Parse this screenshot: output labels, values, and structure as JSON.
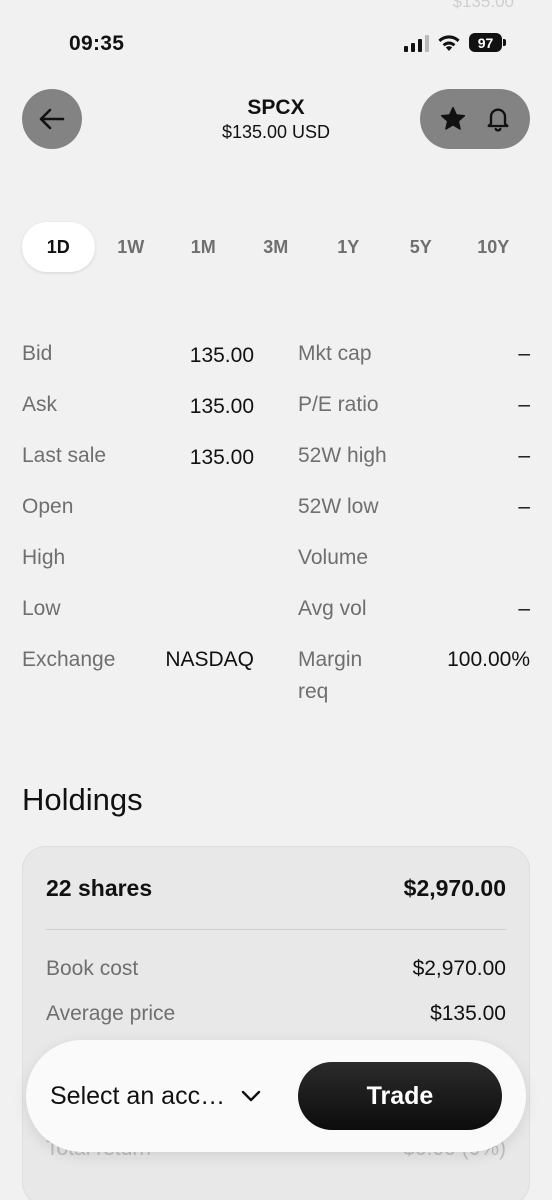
{
  "status_bar": {
    "time": "09:35",
    "battery": "97"
  },
  "ghost_text": "$135.00",
  "header": {
    "symbol": "SPCX",
    "price": "$135.00 USD"
  },
  "range_tabs": [
    "1D",
    "1W",
    "1M",
    "3M",
    "1Y",
    "5Y",
    "10Y"
  ],
  "active_range": "1D",
  "stats_left": [
    {
      "label": "Bid",
      "value": "135.00"
    },
    {
      "label": "Ask",
      "value": "135.00"
    },
    {
      "label": "Last sale",
      "value": "135.00"
    },
    {
      "label": "Open",
      "value": ""
    },
    {
      "label": "High",
      "value": ""
    },
    {
      "label": "Low",
      "value": ""
    },
    {
      "label": "Exchange",
      "value": "NASDAQ"
    }
  ],
  "stats_right": [
    {
      "label": "Mkt cap",
      "value": "–"
    },
    {
      "label": "P/E ratio",
      "value": "–"
    },
    {
      "label": "52W high",
      "value": "–"
    },
    {
      "label": "52W low",
      "value": "–"
    },
    {
      "label": "Volume",
      "value": ""
    },
    {
      "label": "Avg vol",
      "value": "–"
    },
    {
      "label": "Margin",
      "label2": "req",
      "value": "100.00%"
    }
  ],
  "holdings": {
    "title": "Holdings",
    "shares": "22 shares",
    "market_value": "$2,970.00",
    "rows": [
      {
        "label": "Book cost",
        "value": "$2,970.00"
      },
      {
        "label": "Average price",
        "value": "$135.00"
      }
    ],
    "total_return_label": "Total return",
    "total_return_value": "$0.00 (0%)"
  },
  "trade_bar": {
    "account_placeholder": "Select an acc…",
    "trade_label": "Trade"
  },
  "colors": {
    "background": "#f1f1f1",
    "icon_button": "#838383",
    "trade_button": "#111111",
    "muted_text": "#6f6f6f"
  }
}
